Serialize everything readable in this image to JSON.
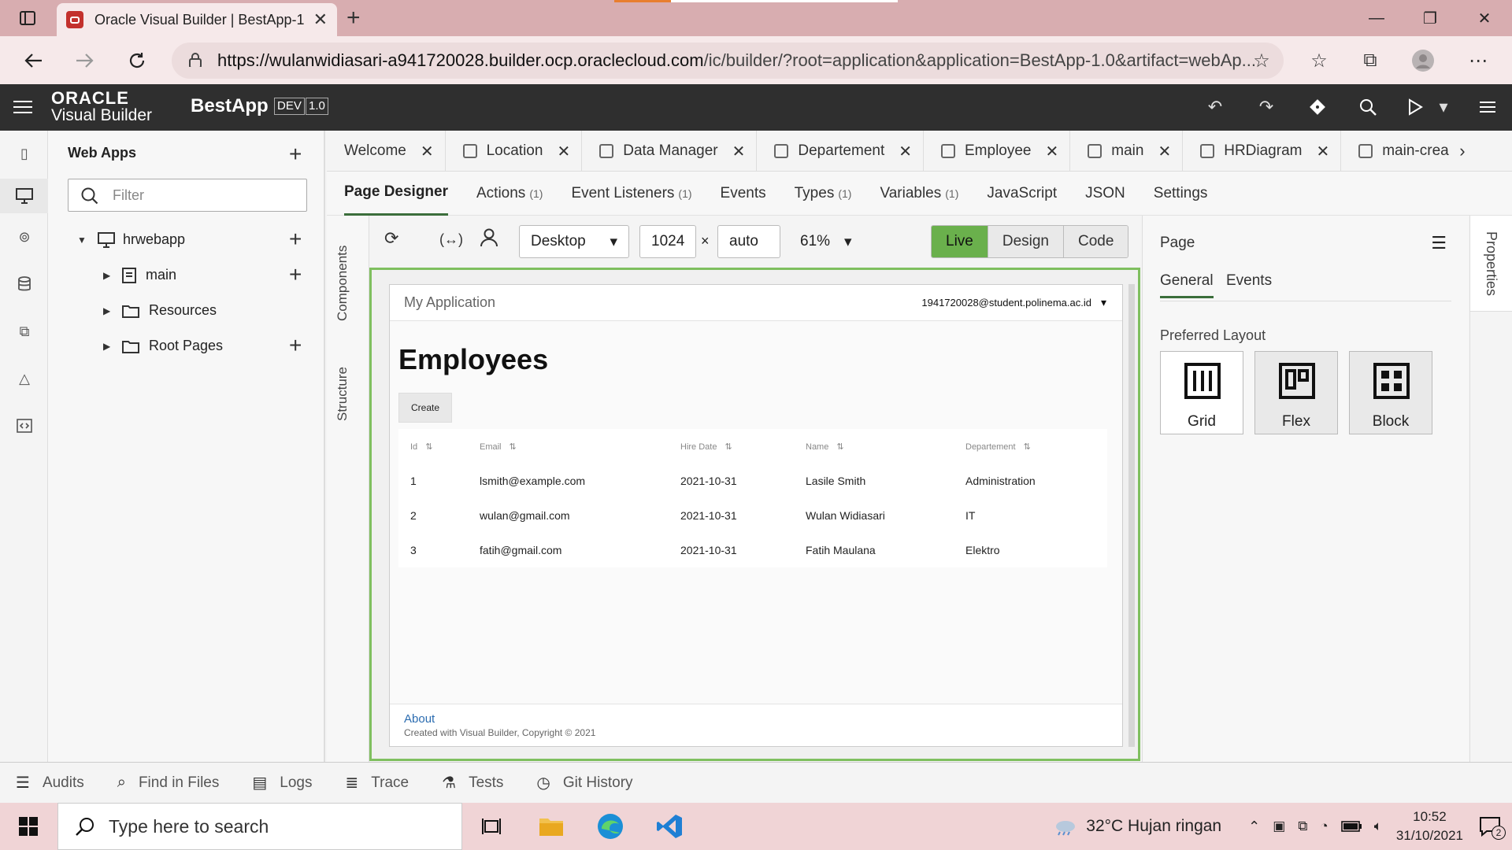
{
  "browser": {
    "tab_title": "Oracle Visual Builder | BestApp-1",
    "url_host": "https://wulanwidiasari-a941720028.builder.ocp.oraclecloud.com",
    "url_path": "/ic/builder/?root=application&application=BestApp-1.0&artifact=webAp..."
  },
  "header": {
    "brand_line1": "ORACLE",
    "brand_line2": "Visual Builder",
    "app_name": "BestApp",
    "env_badge": "DEV",
    "version_badge": "1.0"
  },
  "webapps": {
    "title": "Web Apps",
    "filter_placeholder": "Filter",
    "tree": {
      "root": "hrwebapp",
      "main": "main",
      "resources": "Resources",
      "root_pages": "Root Pages"
    }
  },
  "editor_tabs": [
    "Welcome",
    "Location",
    "Data Manager",
    "Departement",
    "Employee",
    "main",
    "HRDiagram",
    "main-crea"
  ],
  "sub_tabs": {
    "page_designer": "Page Designer",
    "actions": "Actions",
    "actions_count": "(1)",
    "event_listeners": "Event Listeners",
    "event_listeners_count": "(1)",
    "events": "Events",
    "types": "Types",
    "types_count": "(1)",
    "variables": "Variables",
    "variables_count": "(1)",
    "javascript": "JavaScript",
    "json": "JSON",
    "settings": "Settings"
  },
  "side_labels": {
    "components": "Components",
    "structure": "Structure"
  },
  "toolbar": {
    "device": "Desktop",
    "width": "1024",
    "times": "×",
    "height": "auto",
    "zoom": "61%",
    "mode_live": "Live",
    "mode_design": "Design",
    "mode_code": "Code"
  },
  "preview": {
    "app_title": "My Application",
    "user": "1941720028@student.polinema.ac.id",
    "heading": "Employees",
    "create_label": "Create",
    "columns": [
      "Id",
      "Email",
      "Hire Date",
      "Name",
      "Departement"
    ],
    "rows": [
      [
        "1",
        "lsmith@example.com",
        "2021-10-31",
        "Lasile Smith",
        "Administration"
      ],
      [
        "2",
        "wulan@gmail.com",
        "2021-10-31",
        "Wulan Widiasari",
        "IT"
      ],
      [
        "3",
        "fatih@gmail.com",
        "2021-10-31",
        "Fatih Maulana",
        "Elektro"
      ]
    ],
    "footer_link": "About",
    "footer_text": "Created with Visual Builder, Copyright © 2021"
  },
  "properties": {
    "title": "Page",
    "tab_general": "General",
    "tab_events": "Events",
    "preferred_layout": "Preferred Layout",
    "layout_grid": "Grid",
    "layout_flex": "Flex",
    "layout_block": "Block",
    "side_tab": "Properties"
  },
  "bottom_tabs": [
    "Audits",
    "Find in Files",
    "Logs",
    "Trace",
    "Tests",
    "Git History"
  ],
  "taskbar": {
    "search_placeholder": "Type here to search",
    "weather": "32°C  Hujan ringan",
    "time": "10:52",
    "date": "31/10/2021",
    "notif_count": "2"
  },
  "colors": {
    "live_green": "#6ab04c",
    "canvas_border": "#7fbf5f",
    "header_bg": "#2f2f2f"
  }
}
